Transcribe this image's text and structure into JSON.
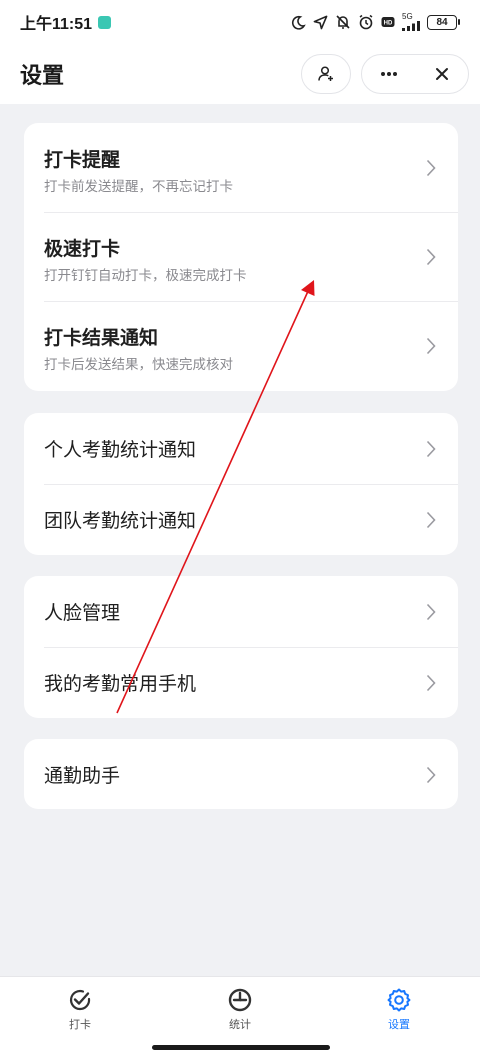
{
  "status_bar": {
    "time": "上午11:51",
    "network": "5G",
    "battery": "84"
  },
  "header": {
    "title": "设置"
  },
  "groups": [
    {
      "items": [
        {
          "title": "打卡提醒",
          "subtitle": "打卡前发送提醒，不再忘记打卡"
        },
        {
          "title": "极速打卡",
          "subtitle": "打开钉钉自动打卡，极速完成打卡"
        },
        {
          "title": "打卡结果通知",
          "subtitle": "打卡后发送结果，快速完成核对"
        }
      ]
    },
    {
      "items": [
        {
          "title": "个人考勤统计通知"
        },
        {
          "title": "团队考勤统计通知"
        }
      ]
    },
    {
      "items": [
        {
          "title": "人脸管理"
        },
        {
          "title": "我的考勤常用手机"
        }
      ]
    },
    {
      "items": [
        {
          "title": "通勤助手"
        }
      ]
    }
  ],
  "bottom_nav": {
    "tabs": [
      {
        "label": "打卡",
        "icon": "check-clock-icon",
        "active": false
      },
      {
        "label": "统计",
        "icon": "pie-chart-icon",
        "active": false
      },
      {
        "label": "设置",
        "icon": "gear-icon",
        "active": true
      }
    ]
  },
  "colors": {
    "accent": "#1677ff",
    "annotation": "#e0151b",
    "background": "#f0f1f4"
  },
  "icons": {
    "status": [
      "moon-icon",
      "location-icon",
      "mute-icon",
      "alarm-icon",
      "hd-icon",
      "signal-icon",
      "battery-icon"
    ],
    "header": [
      "add-contact-icon",
      "more-icon",
      "close-icon"
    ]
  }
}
